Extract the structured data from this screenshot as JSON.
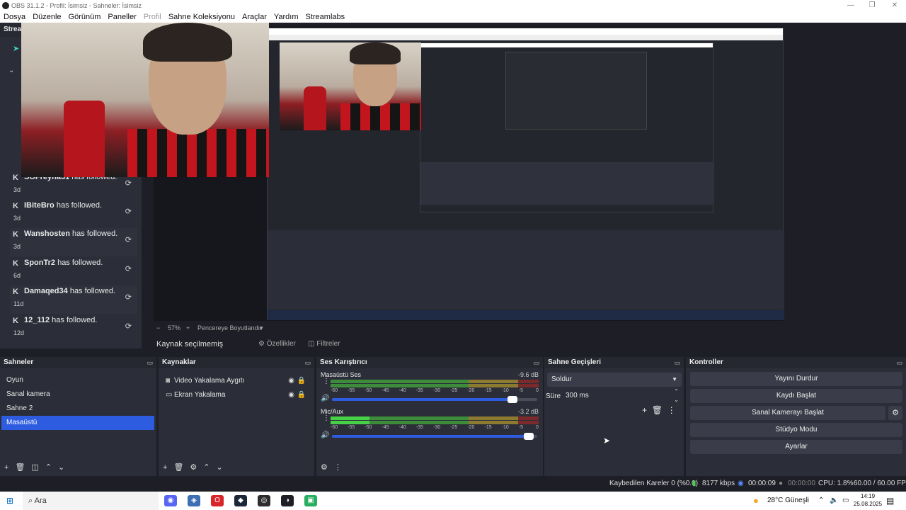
{
  "window": {
    "title": "OBS 31.1.2 - Profil: İsimsiz - Sahneler: İsimsiz",
    "min": "—",
    "max": "❐",
    "close": "✕"
  },
  "menu": [
    "Dosya",
    "Düzenle",
    "Görünüm",
    "Paneller",
    "Profil",
    "Sahne Koleksiyonu",
    "Araçlar",
    "Yardım",
    "Streamlabs"
  ],
  "dock_panel": {
    "title": "Strea",
    "follows": [
      {
        "name": "SOFreyna31",
        "text": " has followed.",
        "ago": "3d"
      },
      {
        "name": "IBiteBro",
        "text": " has followed.",
        "ago": "3d"
      },
      {
        "name": "Wanshosten",
        "text": " has followed.",
        "ago": "3d"
      },
      {
        "name": "SponTr2",
        "text": " has followed.",
        "ago": "6d"
      },
      {
        "name": "Damaqed34",
        "text": " has followed.",
        "ago": "11d"
      },
      {
        "name": "12_112",
        "text": " has followed.",
        "ago": "12d"
      }
    ]
  },
  "zoom": {
    "minus": "−",
    "value": "57%",
    "plus": "+",
    "fit": "Pencereye Boyutlandır"
  },
  "source_bar": {
    "label": "Kaynak seçilmemiş",
    "properties": "Özellikler",
    "filters": "Filtreler"
  },
  "scenes": {
    "title": "Sahneler",
    "items": [
      "Oyun",
      "Sanal kamera",
      "Sahne 2",
      "Masaüstü"
    ],
    "selected": 3
  },
  "sources": {
    "title": "Kaynaklar",
    "items": [
      {
        "icon": "camera-icon",
        "label": "Video Yakalama Aygıtı"
      },
      {
        "icon": "monitor-icon",
        "label": "Ekran Yakalama"
      }
    ]
  },
  "mixer": {
    "title": "Ses Karıştırıcı",
    "channels": [
      {
        "name": "Masaüstü Ses",
        "db": "-9.6 dB",
        "level": 0.88
      },
      {
        "name": "Mic/Aux",
        "db": "-3.2 dB",
        "level": 0.96
      }
    ],
    "ticks": [
      "-60",
      "-55",
      "-50",
      "-45",
      "-40",
      "-35",
      "-30",
      "-25",
      "-20",
      "-15",
      "-10",
      "-5",
      "0"
    ]
  },
  "transitions": {
    "title": "Sahne Geçişleri",
    "selected": "Soldur",
    "duration_label": "Süre",
    "duration": "300 ms"
  },
  "controls": {
    "title": "Kontroller",
    "buttons": [
      "Yayını Durdur",
      "Kaydı Başlat",
      "Sanal Kamerayı Başlat",
      "Stüdyo Modu",
      "Ayarlar"
    ]
  },
  "status": {
    "dropped": "Kaybedilen Kareler 0 (%0.0)",
    "bitrate": "8177 kbps",
    "stream_time": "00:00:09",
    "rec_time": "00:00:00",
    "cpu": "CPU: 1.8%",
    "fps": "60.00 / 60.00 FPS"
  },
  "taskbar": {
    "search": "Ara",
    "weather": "28°C Güneşli",
    "time": "14:19",
    "date": "25.08.2025"
  },
  "colors": {
    "accent": "#2d5ce0",
    "panel": "#2b2e38",
    "bg": "#1e1f26"
  }
}
